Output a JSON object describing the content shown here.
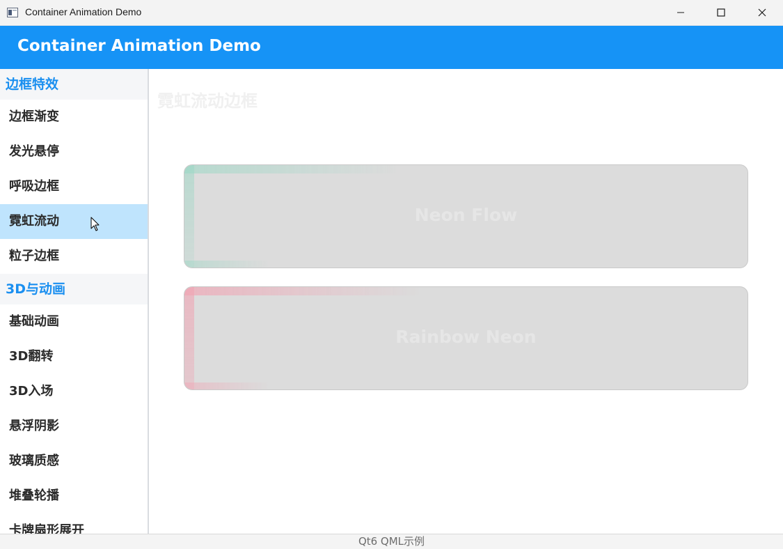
{
  "window": {
    "title": "Container Animation Demo"
  },
  "header": {
    "title": "Container Animation Demo"
  },
  "sidebar": {
    "sections": [
      {
        "title": "边框特效",
        "items": [
          "边框渐变",
          "发光悬停",
          "呼吸边框",
          "霓虹流动",
          "粒子边框"
        ]
      },
      {
        "title": "3D与动画",
        "items": [
          "基础动画",
          "3D翻转",
          "3D入场",
          "悬浮阴影",
          "玻璃质感",
          "堆叠轮播",
          "卡牌扇形展开"
        ]
      }
    ],
    "active_item": "霓虹流动"
  },
  "main": {
    "page_title": "霓虹流动边框",
    "cards": [
      {
        "label": "Neon Flow",
        "glow_color": "#96d7c3"
      },
      {
        "label": "Rainbow Neon",
        "glow_color": "#f0a5b4"
      }
    ]
  },
  "footer": {
    "text": "Qt6 QML示例"
  },
  "colors": {
    "header_bg": "#1693f6",
    "section_text": "#1a8ff0",
    "active_item_bg": "#bfe4fd",
    "card_bg": "#dcdcdc"
  },
  "icons": {
    "app": "app-window-icon",
    "minimize": "minimize-icon",
    "maximize": "maximize-icon",
    "close": "close-icon",
    "cursor": "mouse-cursor-icon"
  }
}
